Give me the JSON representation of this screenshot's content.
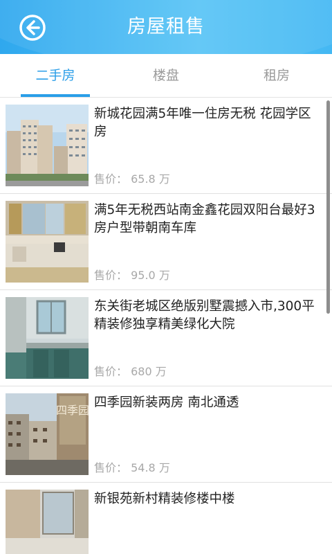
{
  "header": {
    "title": "房屋租售",
    "back_icon": "back-arrow-icon",
    "colors": {
      "start": "#2fa8ee",
      "end": "#58c4f6"
    }
  },
  "tabs": [
    {
      "label": "二手房",
      "active": true
    },
    {
      "label": "楼盘",
      "active": false
    },
    {
      "label": "租房",
      "active": false
    }
  ],
  "accent_color": "#2a9ee8",
  "listings": [
    {
      "title": "新城花园满5年唯一住房无税 花园学区房",
      "price_label": "售价：",
      "price": "65.8",
      "unit": "万"
    },
    {
      "title": "满5年无税西站南金鑫花园双阳台最好3房户型带朝南车库",
      "price_label": "售价：",
      "price": "95.0",
      "unit": "万"
    },
    {
      "title": "东关街老城区绝版别墅震撼入市,300平精装修独享精美绿化大院",
      "price_label": "售价：",
      "price": "680",
      "unit": "万"
    },
    {
      "title": "四季园新装两房 南北通透",
      "price_label": "售价：",
      "price": "54.8",
      "unit": "万"
    },
    {
      "title": "新银苑新村精装修楼中楼",
      "price_label": "",
      "price": "",
      "unit": ""
    }
  ],
  "thumb_sign_text": "四季园"
}
